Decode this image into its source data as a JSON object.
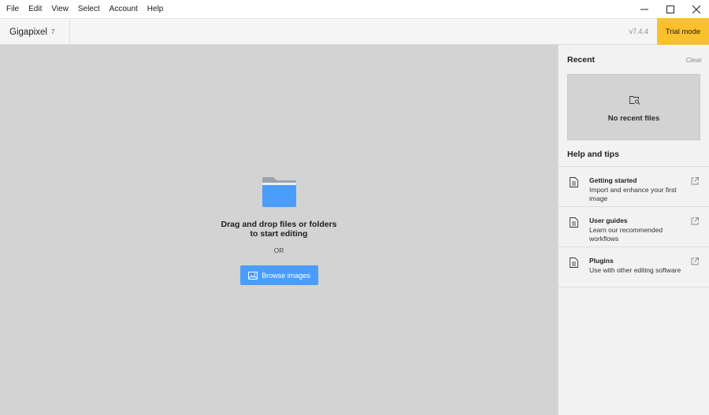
{
  "menu": [
    "File",
    "Edit",
    "View",
    "Select",
    "Account",
    "Help"
  ],
  "window_controls": {
    "minimize": "minimize-icon",
    "maximize": "maximize-icon",
    "close": "close-icon"
  },
  "header": {
    "app_name": "Gigapixel",
    "app_major": "7",
    "version": "v7.4.4",
    "trial_label": "Trial mode",
    "trial_color": "#fbc02d"
  },
  "dropzone": {
    "line1": "Drag and drop files or folders",
    "line2": "to start editing",
    "or": "OR",
    "browse_label": "Browse images",
    "accent": "#4a9dfa"
  },
  "sidebar": {
    "recent_title": "Recent",
    "clear_label": "Clear",
    "recent_empty": "No recent files",
    "help_title": "Help and tips",
    "tips": [
      {
        "title": "Getting started",
        "desc": "Import and enhance your first image"
      },
      {
        "title": "User guides",
        "desc": "Learn our recommended workflows"
      },
      {
        "title": "Plugins",
        "desc": "Use with other editing software"
      }
    ]
  }
}
